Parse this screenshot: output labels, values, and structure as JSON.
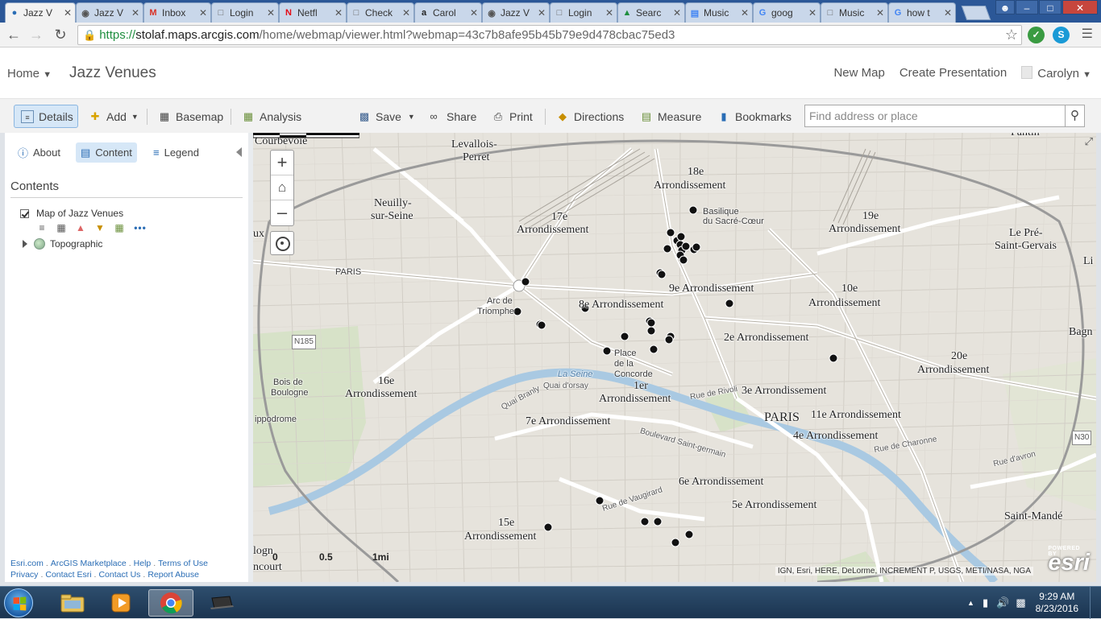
{
  "browser": {
    "tabs": [
      {
        "title": "Jazz V",
        "icon": "arcgis-globe-icon",
        "active": true
      },
      {
        "title": "Jazz V",
        "icon": "record-dot-icon"
      },
      {
        "title": "Inbox",
        "icon": "gmail-icon"
      },
      {
        "title": "Login",
        "icon": "page-icon"
      },
      {
        "title": "Netfl",
        "icon": "netflix-icon"
      },
      {
        "title": "Check",
        "icon": "page-icon"
      },
      {
        "title": "Carol",
        "icon": "amazon-icon"
      },
      {
        "title": "Jazz V",
        "icon": "record-dot-icon"
      },
      {
        "title": "Login",
        "icon": "page-icon"
      },
      {
        "title": "Searc",
        "icon": "drive-icon"
      },
      {
        "title": "Music",
        "icon": "docs-icon"
      },
      {
        "title": "goog",
        "icon": "google-icon"
      },
      {
        "title": "Music",
        "icon": "page-icon"
      },
      {
        "title": "how t",
        "icon": "google-icon"
      }
    ],
    "url": {
      "protocol": "https://",
      "host": "stolaf.maps.arcgis.com",
      "path": "/home/webmap/viewer.html?webmap=43c7b8afe95b45b79e9d478cbac75ed3"
    }
  },
  "app": {
    "home_label": "Home",
    "map_title": "Jazz Venues",
    "new_map": "New Map",
    "create_presentation": "Create Presentation",
    "user": "Carolyn"
  },
  "toolbar": {
    "details": "Details",
    "add": "Add",
    "basemap": "Basemap",
    "analysis": "Analysis",
    "save": "Save",
    "share": "Share",
    "print": "Print",
    "directions": "Directions",
    "measure": "Measure",
    "bookmarks": "Bookmarks",
    "search_placeholder": "Find address or place"
  },
  "panel": {
    "tab_about": "About",
    "tab_content": "Content",
    "tab_legend": "Legend",
    "contents_title": "Contents",
    "layer_name": "Map of Jazz Venues",
    "basemap_name": "Topographic",
    "footer": {
      "esri": "Esri.com",
      "marketplace": "ArcGIS Marketplace",
      "help": "Help",
      "terms": "Terms of Use",
      "privacy": "Privacy",
      "contact_esri": "Contact Esri",
      "contact_us": "Contact Us",
      "report": "Report Abuse"
    }
  },
  "map": {
    "labels": {
      "courbevoie": "Courbevoie",
      "levallois": "Levallois-",
      "levallois2": "Perret",
      "neuilly": "Neuilly-",
      "neuilly2": "sur-Seine",
      "a17": "17e",
      "a17b": "Arrondissement",
      "a18": "18e",
      "a18b": "Arrondissement",
      "basilique": "Basilique",
      "basilique2": "du Sacré-Cœur",
      "a19": "19e",
      "a19b": "Arrondissement",
      "prestgervais": "Le Pré-",
      "prestgervais2": "Saint-Gervais",
      "a9": "9e Arrondissement",
      "a8": "8e Arrondissement",
      "a10": "10e",
      "a10b": "Arrondissement",
      "arc": "Arc de",
      "arc2": "Triomphe",
      "a2": "2e Arrondissement",
      "a20": "20e",
      "a20b": "Arrondissement",
      "bois": "Bois de",
      "bois2": "Boulogne",
      "a16": "16e",
      "a16b": "Arrondissement",
      "concorde": "Place",
      "concorde2": "de la",
      "concorde3": "Concorde",
      "seine": "La Seine",
      "a1": "1er",
      "a1b": "Arrondissement",
      "a3": "3e Arrondissement",
      "paris": "PARIS",
      "paris_small": "PARIS",
      "a11": "11e Arrondissement",
      "a7": "7e Arrondissement",
      "a4": "4e Arrondissement",
      "a6": "6e Arrondissement",
      "a5": "5e Arrondissement",
      "a15": "15e",
      "a15b": "Arrondissement",
      "saintmande": "Saint-Mandé",
      "bagn": "Bagn",
      "li": "Li",
      "ux": "ux",
      "hippodrome": "ippodrome",
      "logn": "logn",
      "ncourt": "ncourt",
      "n185": "N185",
      "n30": "N30",
      "pantin": "Pantin",
      "quai_branly": "Quai Branly",
      "quai_orsay": "Quai d'orsay",
      "rue_rivoli": "Rue de Rivoli",
      "bd_st_germain": "Boulevard Saint-germain",
      "rue_vaugirard": "Rue de Vaugirard",
      "rue_charonne": "Rue de Charonne",
      "rue_avron": "Rue d'avron"
    },
    "scale_0": "0",
    "scale_mid": "0.5",
    "scale_end": "1mi",
    "attribution": "IGN, Esri, HERE, DeLorme, INCREMENT P, USGS, METI/NASA, NGA",
    "esri_small": "POWERED BY",
    "esri_logo": "esri"
  },
  "taskbar": {
    "time": "9:29 AM",
    "date": "8/23/2016"
  }
}
